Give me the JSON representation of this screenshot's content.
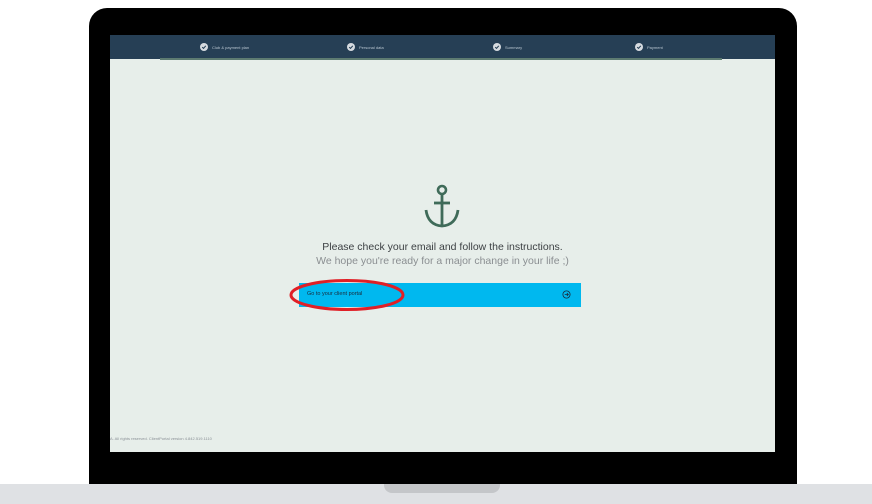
{
  "colors": {
    "topbar": "#263f55",
    "screen_bg": "#e7eeea",
    "button_bg": "#00b8ef",
    "anchor": "#3f6b59",
    "highlight": "#e01f26"
  },
  "progress": {
    "steps": [
      {
        "label": "Club & payment plan",
        "icon": "check-circle-icon",
        "done": true
      },
      {
        "label": "Personal data",
        "icon": "check-circle-icon",
        "done": true
      },
      {
        "label": "Summary",
        "icon": "check-circle-icon",
        "done": true
      },
      {
        "label": "Payment",
        "icon": "check-circle-icon",
        "done": true
      }
    ]
  },
  "main": {
    "icon": "anchor-icon",
    "message_primary": "Please check your email and follow the instructions.",
    "message_secondary": "We hope you're ready for a major change in your life ;)",
    "portal_button_label": "Go to your client portal",
    "portal_button_icon": "arrow-right-circle-icon"
  },
  "footer": {
    "text": "A. All rights reserved. ClientPortal version 4.842.519.1110"
  }
}
